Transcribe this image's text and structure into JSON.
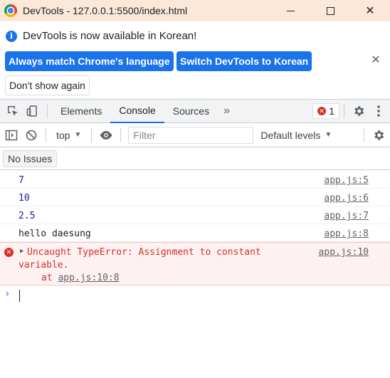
{
  "window": {
    "title": "DevTools - 127.0.0.1:5500/index.html",
    "controls": {
      "minimize": "minimize",
      "maximize": "maximize",
      "close": "✕"
    }
  },
  "infobar": {
    "message": "DevTools is now available in Korean!",
    "info_icon": "i",
    "match_language_button": "Always match Chrome's language",
    "switch_button": "Switch DevTools to Korean",
    "dont_show_button": "Don't show again",
    "close_glyph": "✕"
  },
  "toolbar": {
    "tabs": [
      {
        "label": "Elements",
        "active": false
      },
      {
        "label": "Console",
        "active": true
      },
      {
        "label": "Sources",
        "active": false
      }
    ],
    "more_tabs": "»",
    "error_count": "1",
    "icons": [
      "inspect-icon",
      "device-toggle-icon",
      "gear-icon",
      "more-vertical-icon"
    ]
  },
  "console_toolbar": {
    "context": "top",
    "filter_placeholder": "Filter",
    "levels": "Default levels"
  },
  "issues": {
    "label": "No Issues"
  },
  "messages": [
    {
      "type": "number",
      "text": "7",
      "source": "app.js:5"
    },
    {
      "type": "number",
      "text": "10",
      "source": "app.js:6"
    },
    {
      "type": "number",
      "text": "2.5",
      "source": "app.js:7"
    },
    {
      "type": "string",
      "text": "hello daesung",
      "source": "app.js:8"
    }
  ],
  "error": {
    "line1": "Uncaught TypeError: Assignment to constant",
    "line2": "variable.",
    "at_prefix": "at ",
    "at_link": "app.js:10:8",
    "source": "app.js:10"
  },
  "prompt": {
    "chevron": "›"
  },
  "colors": {
    "accent": "#1a73e8",
    "error": "#d93025",
    "title_bar": "#fbe8d9",
    "number": "#1a1aa6"
  }
}
